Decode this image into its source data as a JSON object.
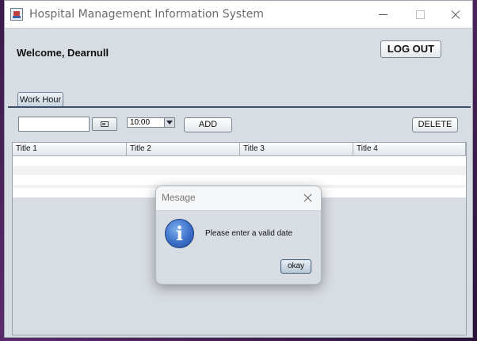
{
  "window": {
    "title": "Hospital Management Information System"
  },
  "header": {
    "welcome_text": "Welcome, Dearnull",
    "logout_label": "LOG OUT"
  },
  "tabs": [
    {
      "label": "Work Hour",
      "selected": true
    }
  ],
  "toolbar": {
    "date_value": "",
    "time_selected": "10:00",
    "add_label": "ADD",
    "delete_label": "DELETE"
  },
  "table": {
    "columns": [
      "Title 1",
      "Title 2",
      "Title 3",
      "Title 4"
    ],
    "rows": []
  },
  "dialog": {
    "title": "Mesage",
    "message": "Please enter a valid date",
    "icon": "info-icon",
    "info_glyph": "i",
    "ok_label": "okay"
  }
}
